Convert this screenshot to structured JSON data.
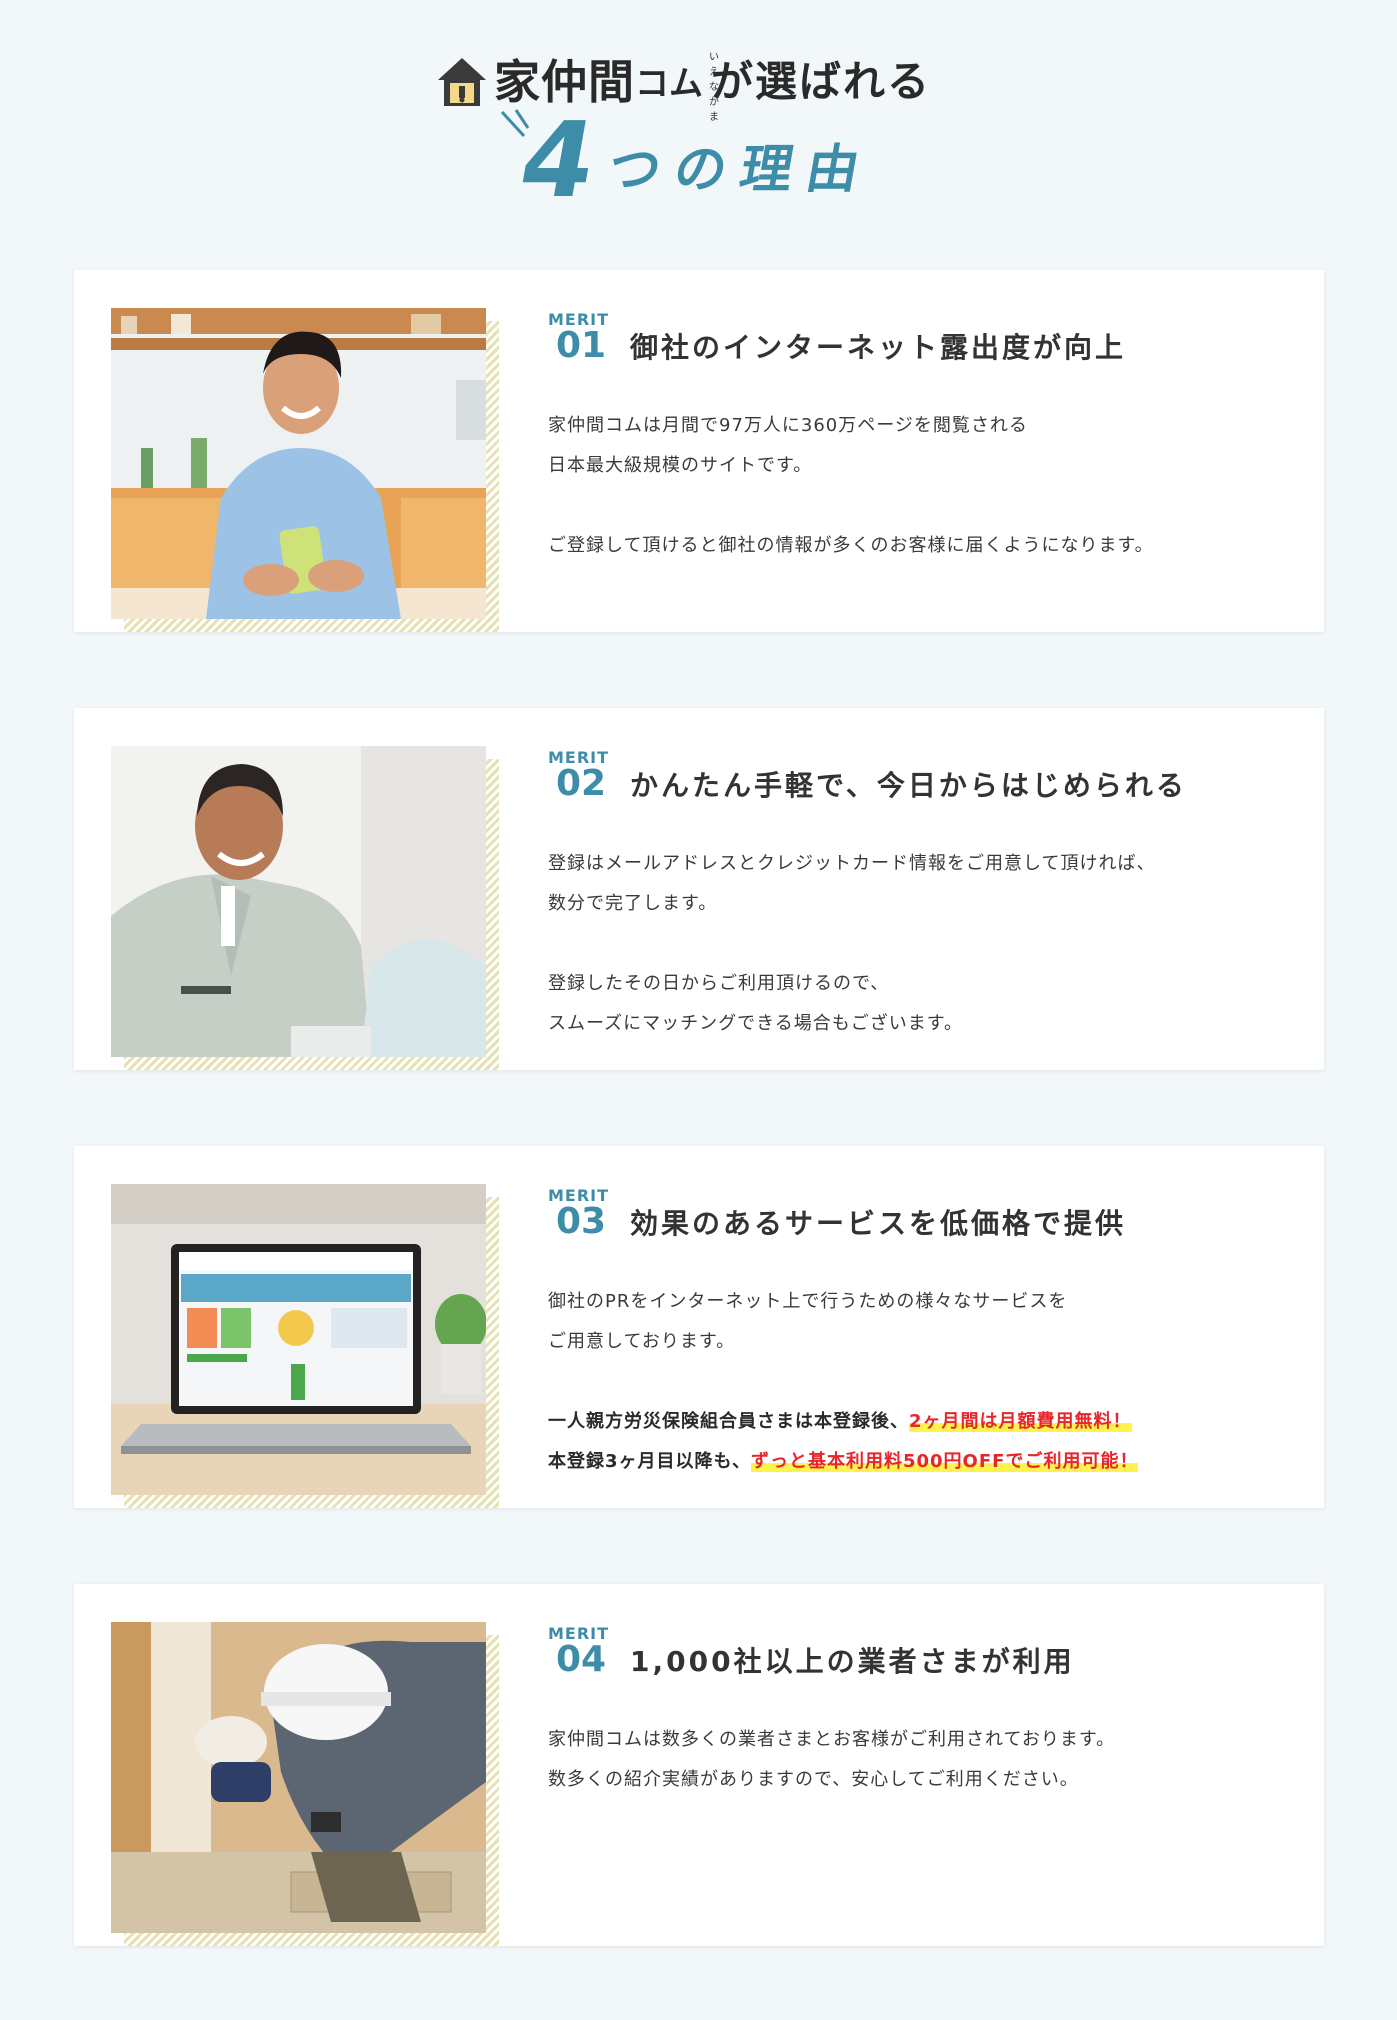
{
  "header": {
    "brand": "家仲間",
    "brand_suffix": "コム",
    "ruby": "いえなかま",
    "tagline": "が選ばれる",
    "number": "4",
    "reason_text": "つの理由"
  },
  "merits": [
    {
      "label": "MERIT",
      "num": "01",
      "title": "御社のインターネット露出度が向上",
      "lines": [
        "家仲間コムは月間で97万人に360万ページを閲覧される",
        "日本最大級規模のサイトです。",
        "",
        "ご登録して頂けると御社の情報が多くのお客様に届くようになります。"
      ]
    },
    {
      "label": "MERIT",
      "num": "02",
      "title": "かんたん手軽で、今日からはじめられる",
      "lines": [
        "登録はメールアドレスとクレジットカード情報をご用意して頂ければ、",
        "数分で完了します。",
        "",
        "登録したその日からご利用頂けるので、",
        "スムーズにマッチングできる場合もございます。"
      ]
    },
    {
      "label": "MERIT",
      "num": "03",
      "title": "効果のあるサービスを低価格で提供",
      "lines": [
        "御社のPRをインターネット上で行うための様々なサービスを",
        "ご用意しております。"
      ],
      "strong_1": "一人親方労災保険組合員さまは本登録後、",
      "highlight_1": "2ヶ月間は月額費用無料！",
      "strong_2": "本登録3ヶ月目以降も、",
      "highlight_2": "ずっと基本利用料500円OFFでご利用可能！"
    },
    {
      "label": "MERIT",
      "num": "04",
      "title": "1,000社以上の業者さまが利用",
      "lines": [
        "家仲間コムは数多くの業者さまとお客様がご利用されております。",
        "数多くの紹介実績がありますので、安心してご利用ください。"
      ]
    }
  ]
}
